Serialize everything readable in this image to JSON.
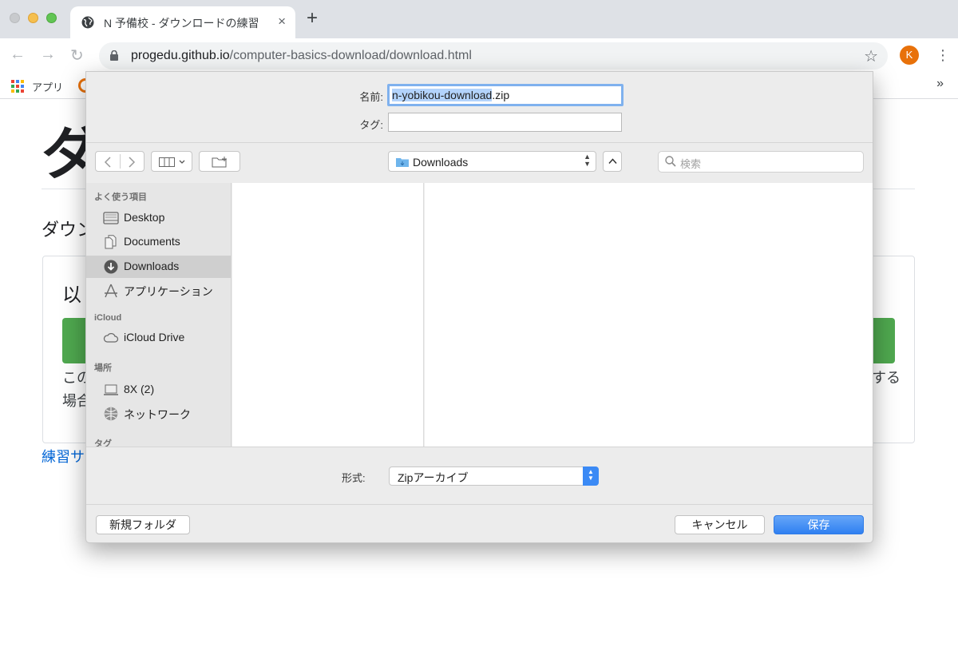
{
  "browser": {
    "tab": {
      "title": "N 予備校 - ダウンロードの練習",
      "close": "×"
    },
    "new_tab": "+",
    "nav": {
      "back": "←",
      "forward": "→",
      "reload": "↻"
    },
    "address": {
      "host": "progedu.github.io",
      "path": "/computer-basics-download/download.html"
    },
    "bookmark_star": "☆",
    "profile_initial": "K",
    "menu": "⋮",
    "bookmarks": {
      "apps_label": "アプリ",
      "more": "»"
    }
  },
  "page": {
    "heading_fragment": "ダ",
    "subheading_fragment": "ダウン",
    "box_heading_fragment": "以",
    "text_line1_fragment": "この",
    "text_line2_fragment": "場合",
    "text_right_fragment": "する",
    "link_fragment": "練習サ"
  },
  "dialog": {
    "name_label": "名前:",
    "name_selected": "n-yobikou-download",
    "name_rest": ".zip",
    "tag_label": "タグ:",
    "tag_value": "",
    "location": "Downloads",
    "search_placeholder": "検索",
    "sidebar": {
      "favorites_header": "よく使う項目",
      "favorites": [
        {
          "label": "Desktop",
          "icon": "desktop-icon"
        },
        {
          "label": "Documents",
          "icon": "documents-icon"
        },
        {
          "label": "Downloads",
          "icon": "downloads-icon",
          "active": true
        },
        {
          "label": "アプリケーション",
          "icon": "applications-icon"
        }
      ],
      "icloud_header": "iCloud",
      "icloud": [
        {
          "label": "iCloud Drive",
          "icon": "cloud-icon"
        }
      ],
      "places_header": "場所",
      "places": [
        {
          "label": "8X (2)",
          "icon": "laptop-icon"
        },
        {
          "label": "ネットワーク",
          "icon": "network-icon"
        }
      ],
      "tags_header": "タグ"
    },
    "format_label": "形式:",
    "format_value": "Zipアーカイブ",
    "new_folder_button": "新規フォルダ",
    "cancel_button": "キャンセル",
    "save_button": "保存"
  }
}
